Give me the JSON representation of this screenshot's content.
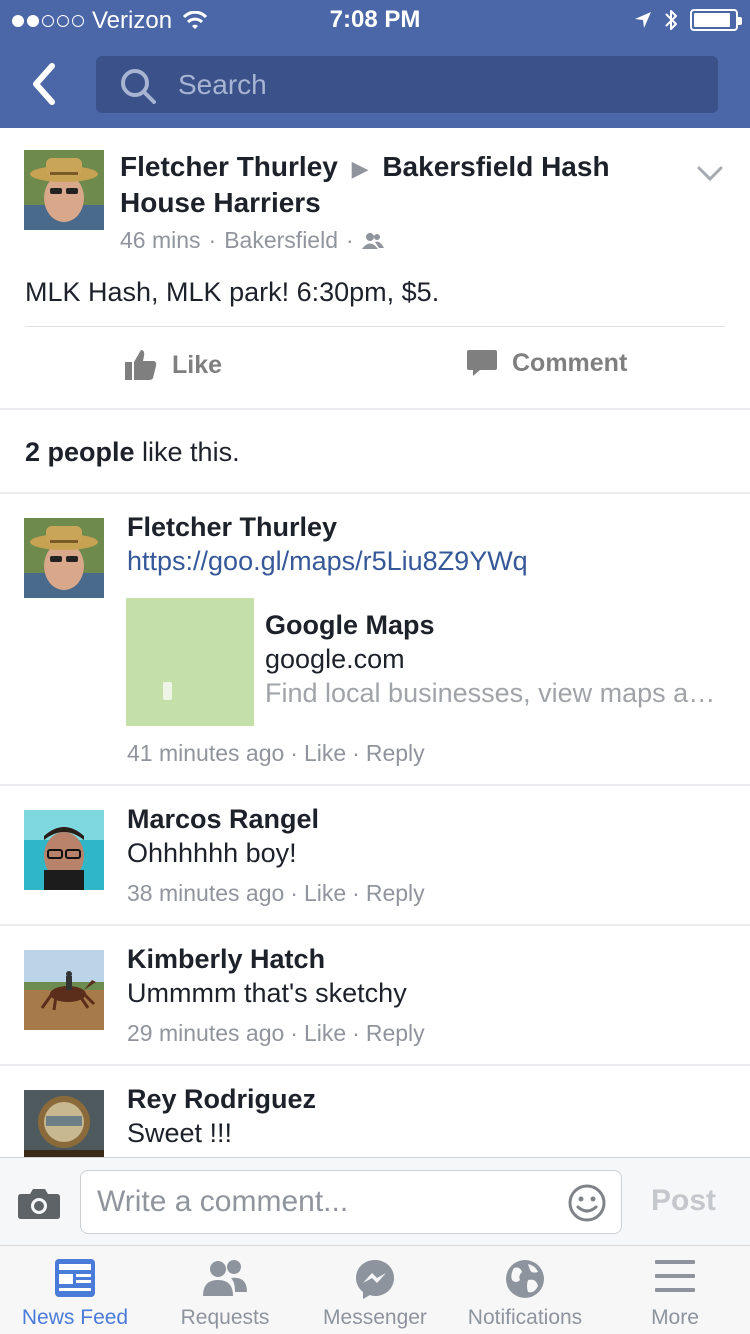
{
  "status_bar": {
    "carrier": "Verizon",
    "time": "7:08 PM",
    "signal_bars_filled": 2,
    "signal_bars_total": 5
  },
  "nav": {
    "search_placeholder": "Search"
  },
  "post": {
    "author": "Fletcher Thurley",
    "group": "Bakersfield Hash House Harriers",
    "time": "46 mins",
    "location": "Bakersfield",
    "text": "MLK Hash, MLK park! 6:30pm, $5.",
    "like_label": "Like",
    "comment_label": "Comment",
    "likes_count": "2 people",
    "likes_suffix": " like this."
  },
  "comments": [
    {
      "name": "Fletcher Thurley",
      "link": "https://goo.gl/maps/r5Liu8Z9YWq",
      "preview": {
        "title": "Google Maps",
        "domain": "google.com",
        "description": "Find local businesses, view maps and get driving directions in Google Maps."
      },
      "time": "41 minutes ago",
      "like": "Like",
      "reply": "Reply"
    },
    {
      "name": "Marcos Rangel",
      "text": "Ohhhhhh boy!",
      "time": "38 minutes ago",
      "like": "Like",
      "reply": "Reply"
    },
    {
      "name": "Kimberly Hatch",
      "text": "Ummmm that's sketchy",
      "time": "29 minutes ago",
      "like": "Like",
      "reply": "Reply"
    },
    {
      "name": "Rey Rodriguez",
      "text": "Sweet !!!"
    }
  ],
  "composer": {
    "placeholder": "Write a comment...",
    "post_label": "Post"
  },
  "tabs": [
    {
      "label": "News Feed",
      "icon": "news-feed-icon",
      "active": true
    },
    {
      "label": "Requests",
      "icon": "friend-requests-icon",
      "active": false
    },
    {
      "label": "Messenger",
      "icon": "messenger-icon",
      "active": false
    },
    {
      "label": "Notifications",
      "icon": "globe-icon",
      "active": false
    },
    {
      "label": "More",
      "icon": "menu-icon",
      "active": false
    }
  ],
  "colors": {
    "nav_blue": "#4b67a8",
    "search_field": "#3a5189",
    "link_blue": "#365899",
    "tab_active": "#4b7bd9",
    "meta_gray": "#90949c"
  }
}
